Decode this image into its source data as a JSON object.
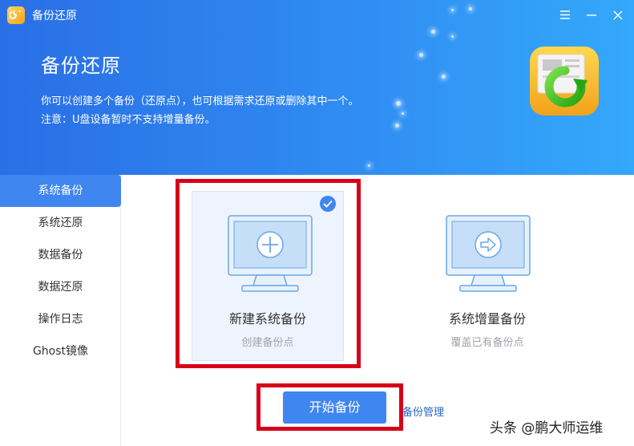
{
  "window": {
    "title": "备份还原"
  },
  "hero": {
    "title": "备份还原",
    "description": "你可以创建多个备份（还原点），也可根据需求还原或删除其中一个。",
    "note": "注意：U盘设备暂时不支持增量备份。"
  },
  "sidebar": {
    "items": [
      {
        "label": "系统备份",
        "active": true
      },
      {
        "label": "系统还原",
        "active": false
      },
      {
        "label": "数据备份",
        "active": false
      },
      {
        "label": "数据还原",
        "active": false
      },
      {
        "label": "操作日志",
        "active": false
      },
      {
        "label": "Ghost镜像",
        "active": false
      }
    ]
  },
  "options": [
    {
      "title": "新建系统备份",
      "subtitle": "创建备份点",
      "selected": true,
      "icon": "monitor-plus-icon"
    },
    {
      "title": "系统增量备份",
      "subtitle": "覆盖已有备份点",
      "selected": false,
      "icon": "monitor-arrow-icon"
    }
  ],
  "actions": {
    "start_label": "开始备份",
    "manage_label": "备份管理"
  },
  "watermark": "头条 @鹏大师运维",
  "colors": {
    "accent": "#3f86f1",
    "highlight_box": "#d7001b",
    "link": "#2b67c8"
  }
}
